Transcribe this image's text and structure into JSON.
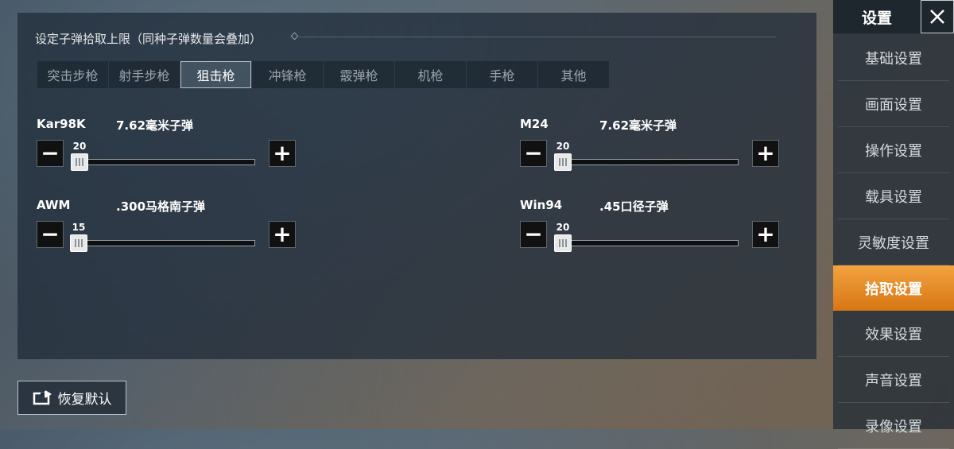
{
  "header": {
    "hint": "设定子弹拾取上限（同种子弹数量会叠加）"
  },
  "tabs": [
    {
      "label": "突击步枪",
      "active": false
    },
    {
      "label": "射手步枪",
      "active": false
    },
    {
      "label": "狙击枪",
      "active": true
    },
    {
      "label": "冲锋枪",
      "active": false
    },
    {
      "label": "霰弹枪",
      "active": false
    },
    {
      "label": "机枪",
      "active": false
    },
    {
      "label": "手枪",
      "active": false
    },
    {
      "label": "其他",
      "active": false
    }
  ],
  "items": [
    {
      "gun": "Kar98K",
      "ammo": "7.62毫米子弹",
      "value": "20",
      "minus": "−",
      "plus": "+"
    },
    {
      "gun": "M24",
      "ammo": "7.62毫米子弹",
      "value": "20",
      "minus": "−",
      "plus": "+"
    },
    {
      "gun": "AWM",
      "ammo": ".300马格南子弹",
      "value": "15",
      "minus": "−",
      "plus": "+"
    },
    {
      "gun": "Win94",
      "ammo": ".45口径子弹",
      "value": "20",
      "minus": "−",
      "plus": "+"
    }
  ],
  "restore": {
    "label": "恢复默认",
    "icon": "restore-icon"
  },
  "sidebar": {
    "title": "设置",
    "close_icon": "close-icon",
    "items": [
      {
        "label": "基础设置",
        "active": false
      },
      {
        "label": "画面设置",
        "active": false
      },
      {
        "label": "操作设置",
        "active": false
      },
      {
        "label": "载具设置",
        "active": false
      },
      {
        "label": "灵敏度设置",
        "active": false
      },
      {
        "label": "拾取设置",
        "active": true
      },
      {
        "label": "效果设置",
        "active": false
      },
      {
        "label": "声音设置",
        "active": false
      },
      {
        "label": "录像设置",
        "active": false
      }
    ]
  },
  "colors": {
    "accent": "#E98A25",
    "panel": "#1E2A37"
  }
}
